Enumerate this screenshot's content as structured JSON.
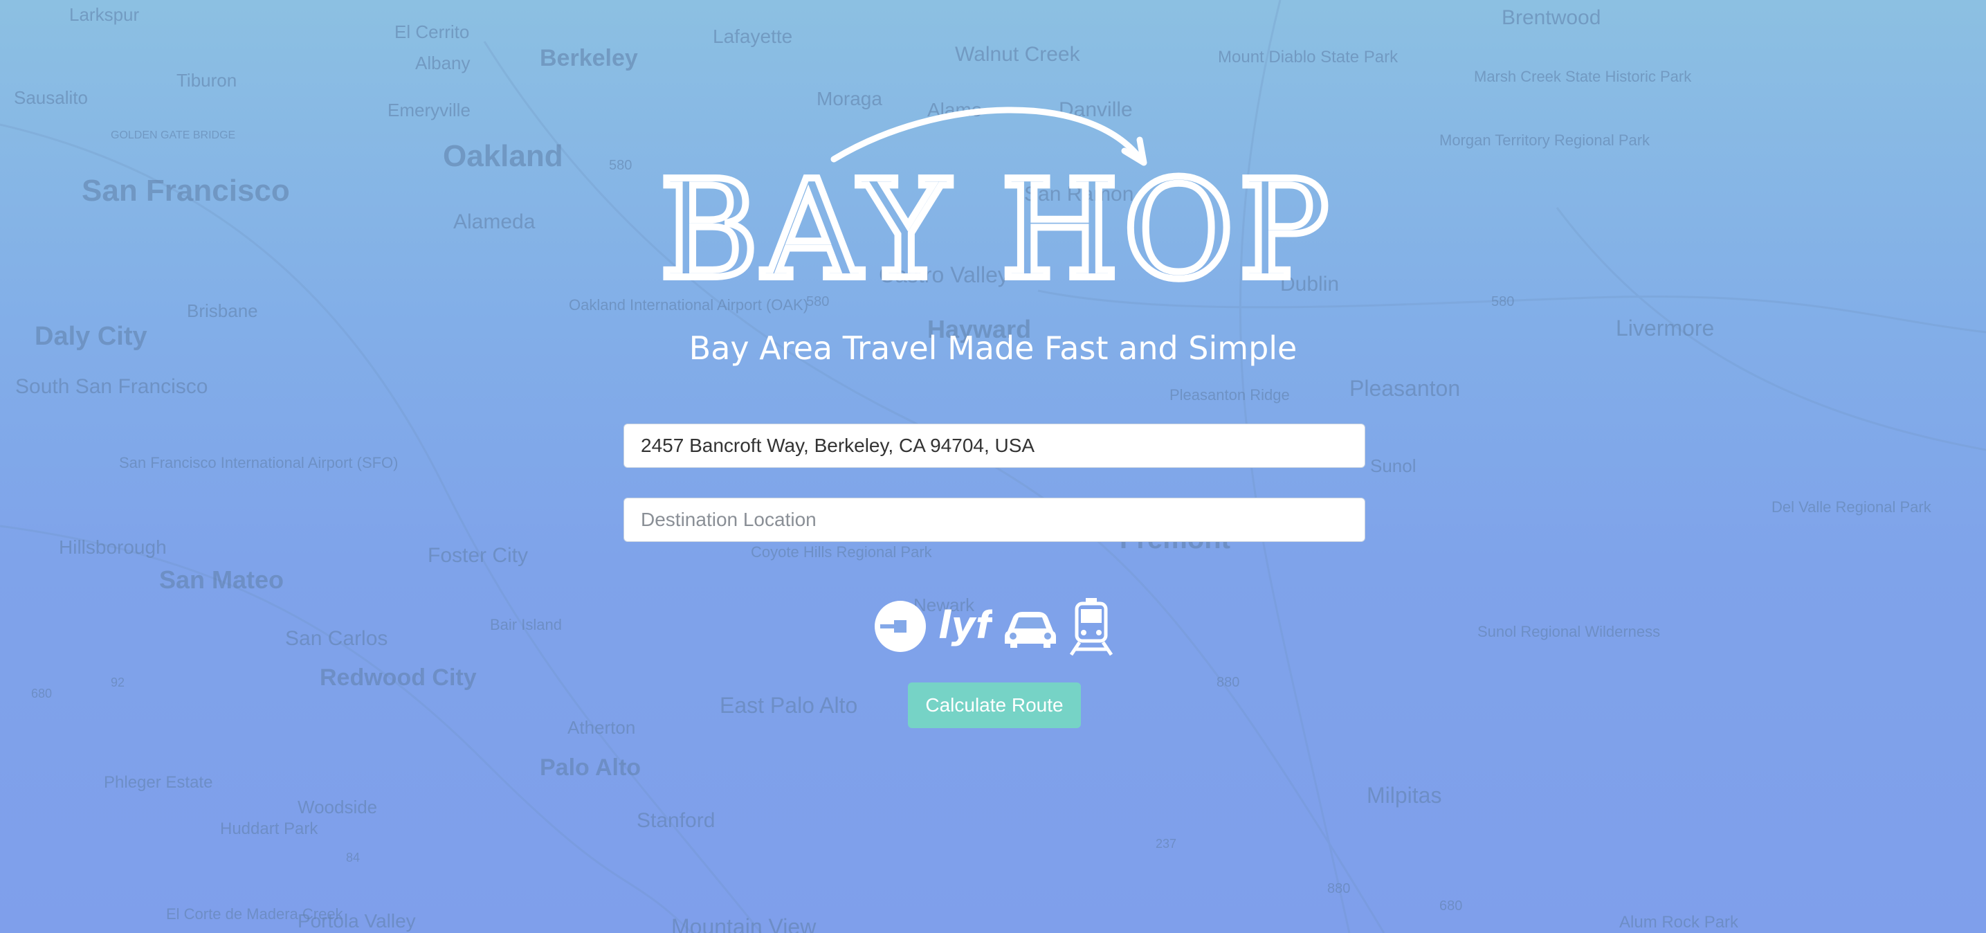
{
  "app": {
    "title": "BAY HOP",
    "tagline": "Bay Area Travel Made Fast and Simple"
  },
  "form": {
    "origin_value": "2457 Bancroft Way, Berkeley, CA 94704, USA",
    "destination_placeholder": "Destination Location",
    "submit_label": "Calculate Route"
  },
  "modes": [
    {
      "name": "uber",
      "icon": "uber-icon"
    },
    {
      "name": "lyft",
      "icon": "lyft-icon",
      "text": "lyft"
    },
    {
      "name": "car",
      "icon": "car-icon"
    },
    {
      "name": "train",
      "icon": "train-icon"
    }
  ],
  "map_labels": [
    "Larkspur",
    "El Cerrito",
    "Lafayette",
    "Walnut Creek",
    "Brentwood",
    "Sausalito",
    "Tiburon",
    "Albany",
    "Berkeley",
    "Moraga",
    "Alamo",
    "Danville",
    "Mount Diablo State Park",
    "Marsh Creek State Historic Park",
    "GOLDEN GATE BRIDGE",
    "Emeryville",
    "Oakland",
    "San Francisco",
    "Alameda",
    "San Ramon",
    "Morgan Territory Regional Park",
    "Castro Valley",
    "Dublin",
    "Brisbane",
    "Oakland International Airport (OAK)",
    "Daly City",
    "Hayward",
    "Livermore",
    "South San Francisco",
    "Pleasanton",
    "Pleasanton Ridge",
    "San Francisco International Airport (SFO)",
    "Sunol",
    "Del Valle Regional Park",
    "Hillsborough",
    "Foster City",
    "Coyote Hills Regional Park",
    "Fremont",
    "San Mateo",
    "Bair Island",
    "Newark",
    "San Carlos",
    "Sunol Regional Wilderness",
    "Redwood City",
    "East Palo Alto",
    "Atherton",
    "Palo Alto",
    "Phleger Estate",
    "Woodside",
    "Huddart Park",
    "Stanford",
    "Milpitas",
    "El Corte de Madera Creek",
    "Portola Valley",
    "Mountain View",
    "Alum Rock Park",
    "580",
    "580",
    "580",
    "880",
    "880",
    "680",
    "680",
    "92",
    "237",
    "84"
  ],
  "colors": {
    "accent_button": "#76d3c6",
    "bg_top": "#8cc0e2",
    "bg_bottom": "#7f9feb"
  }
}
